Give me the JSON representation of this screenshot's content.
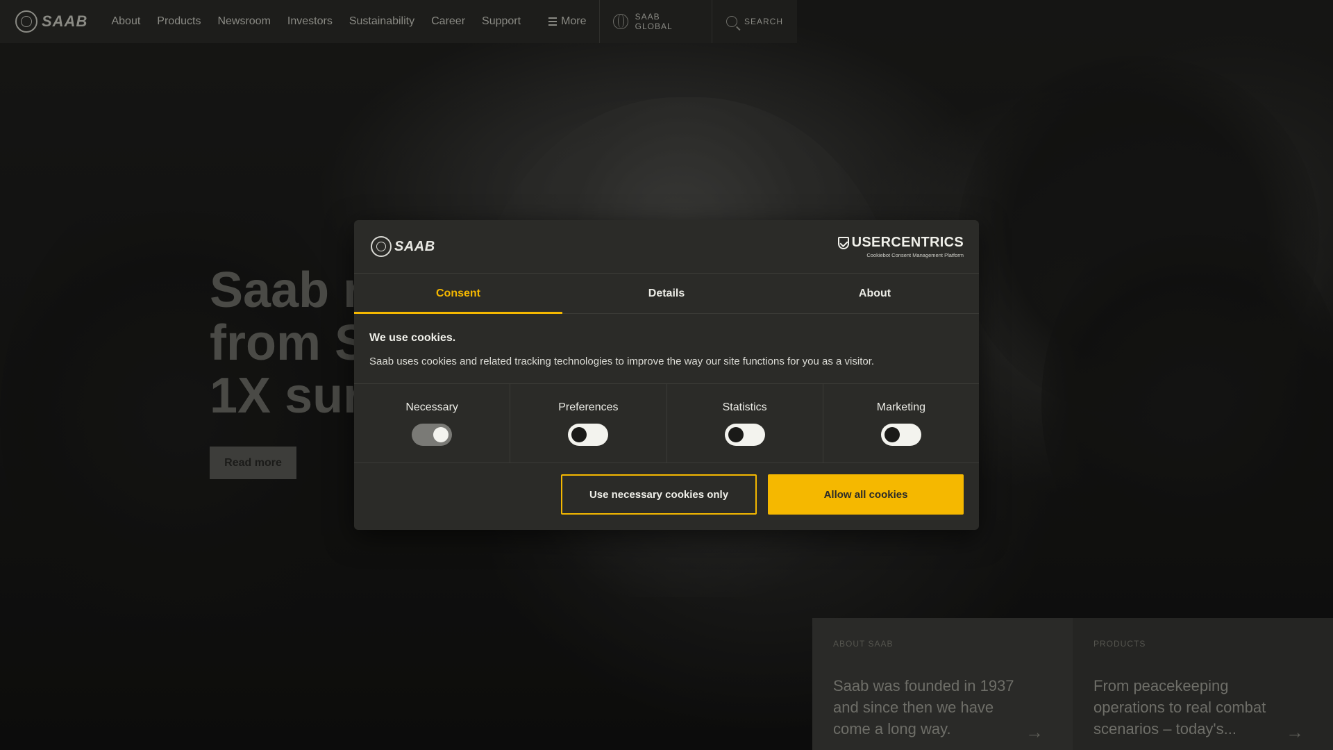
{
  "nav": {
    "brand": "SAAB",
    "links": [
      "About",
      "Products",
      "Newsroom",
      "Investors",
      "Sustainability",
      "Career",
      "Support"
    ],
    "more_label": "More",
    "global_label": "SAAB GLOBAL",
    "search_label": "SEARCH"
  },
  "hero": {
    "title_lines": [
      "Saab r",
      "from S",
      "1X sur"
    ],
    "read_more_label": "Read more"
  },
  "cards": [
    {
      "label": "ABOUT SAAB",
      "text": "Saab was founded in 1937 and since then we have come a long way."
    },
    {
      "label": "PRODUCTS",
      "text": "From peacekeeping operations to real combat scenarios – today's..."
    }
  ],
  "cookie_dialog": {
    "brand": "SAAB",
    "provider_name": "USERCENTRICS",
    "provider_tagline": "Cookiebot Consent Management Platform",
    "tabs": [
      {
        "label": "Consent",
        "active": true
      },
      {
        "label": "Details",
        "active": false
      },
      {
        "label": "About",
        "active": false
      }
    ],
    "heading": "We use cookies.",
    "description": "Saab uses cookies and related tracking technologies to improve the way our site functions for you as a visitor.",
    "categories": [
      {
        "label": "Necessary",
        "enabled": true,
        "locked": true
      },
      {
        "label": "Preferences",
        "enabled": false,
        "locked": false
      },
      {
        "label": "Statistics",
        "enabled": false,
        "locked": false
      },
      {
        "label": "Marketing",
        "enabled": false,
        "locked": false
      }
    ],
    "buttons": {
      "necessary_only": "Use necessary cookies only",
      "allow_all": "Allow all cookies"
    },
    "accent_color": "#f5b800"
  }
}
